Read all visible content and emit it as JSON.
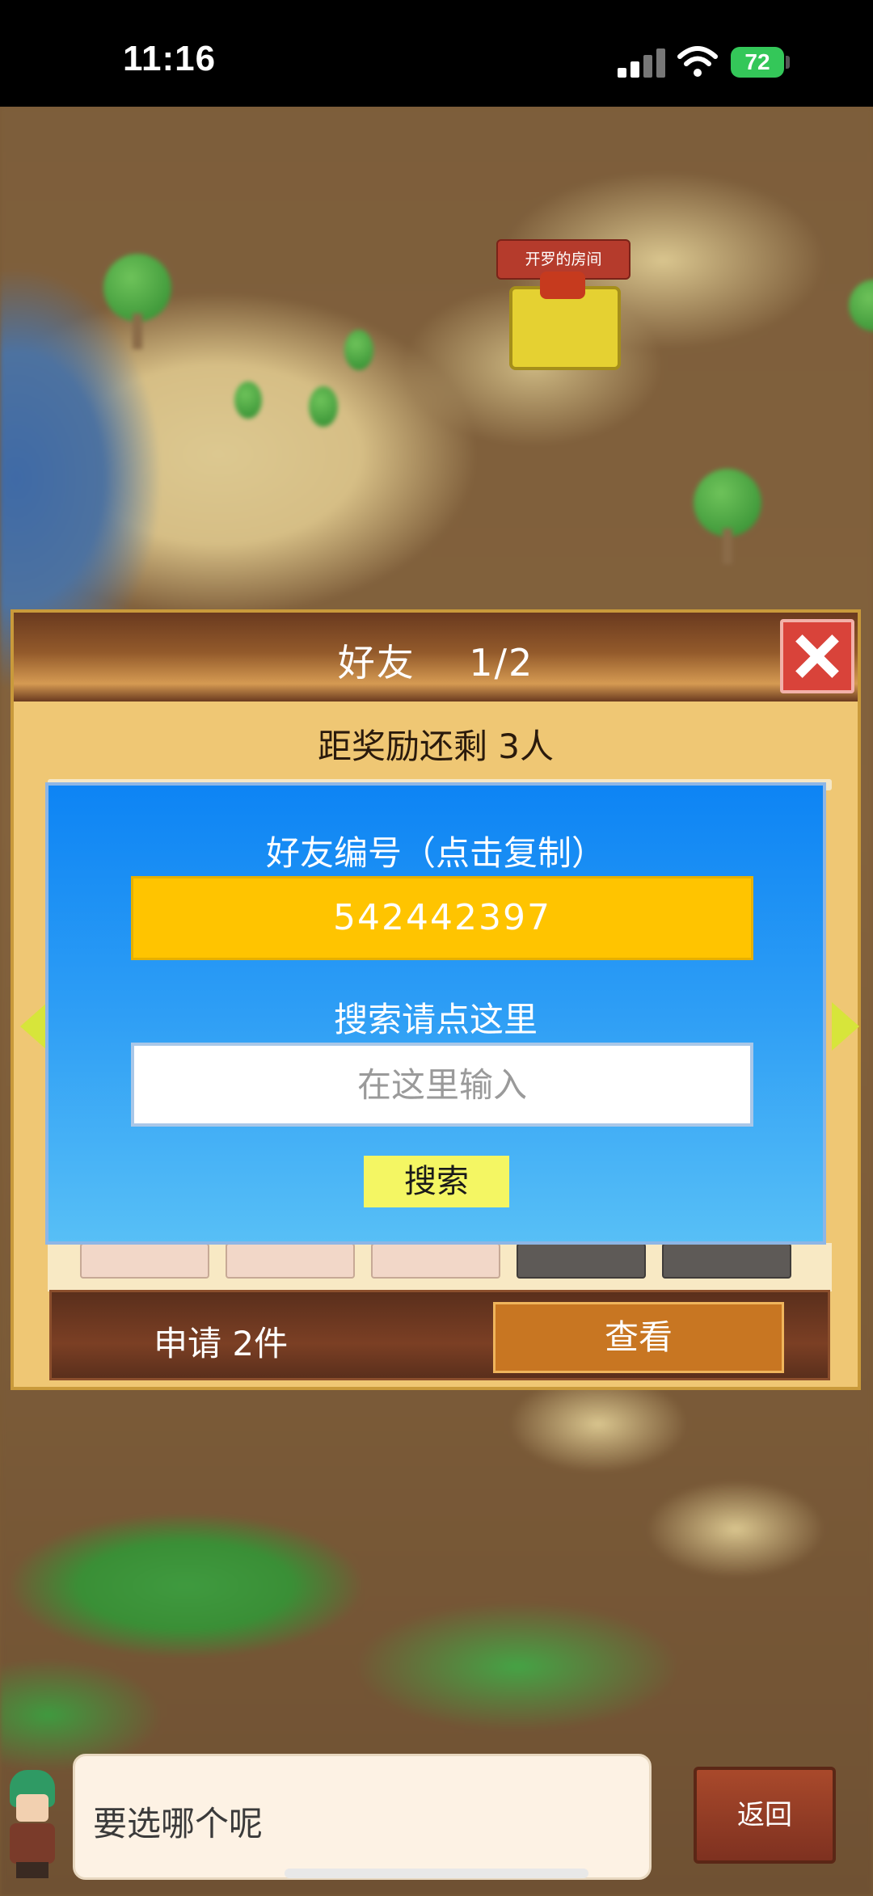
{
  "status_bar": {
    "time": "11:16",
    "battery": "72"
  },
  "map": {
    "room_label": "开罗的房间"
  },
  "friends_dialog": {
    "title": "好友    1/2",
    "reward_progress": "距奖励还剩 3人",
    "requests_label": "申请 2件",
    "view_button": "查看"
  },
  "search_panel": {
    "friend_id_label": "好友编号（点击复制）",
    "friend_id": "542442397",
    "search_label": "搜索请点这里",
    "search_placeholder": "在这里输入",
    "search_button": "搜索"
  },
  "bottom": {
    "speech": "要选哪个呢",
    "back_button": "返回"
  },
  "colors": {
    "panel_blue": "#0d84f4",
    "friend_id_yellow": "#ffc400",
    "search_button_yellow": "#f4f663",
    "close_red": "#d9433a",
    "view_button_orange": "#c87622",
    "battery_green": "#34c759"
  },
  "icons": {
    "close": "close-icon",
    "nav_left": "arrow-left-icon",
    "nav_right": "arrow-right-icon",
    "signal": "cellular-signal-icon",
    "wifi": "wifi-icon",
    "battery": "battery-charging-icon"
  }
}
